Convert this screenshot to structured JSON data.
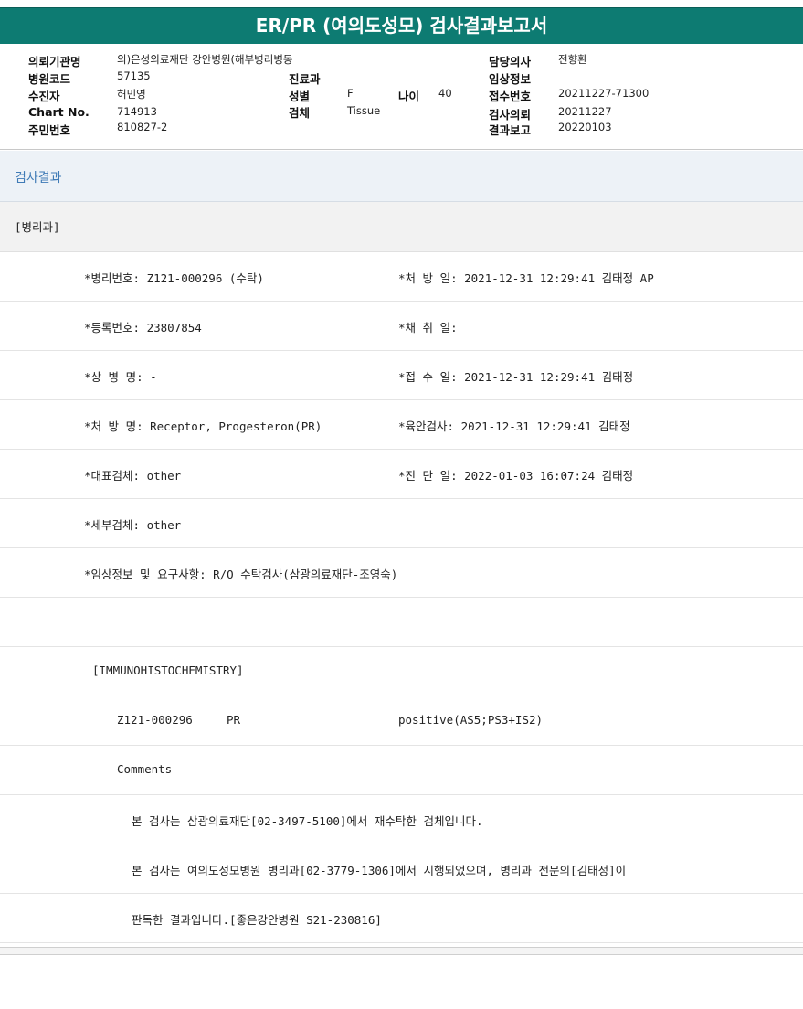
{
  "title": "ER/PR (여의도성모) 검사결과보고서",
  "info": {
    "institution_label": "의뢰기관명",
    "institution": "의)은성의료재단 강안병원(해부병리병동",
    "hospital_code_label": "병원코드",
    "hospital_code": "57135",
    "patient_label": "수진자",
    "patient": "허민영",
    "chart_label": "Chart No.",
    "chart": "714913",
    "rrn_label": "주민번호",
    "rrn": "810827-2",
    "dept_label": "진료과",
    "dept": "",
    "sex_label": "성별",
    "sex": "F",
    "age_label": "나이",
    "age": "40",
    "specimen_label": "검체",
    "specimen": "Tissue",
    "doctor_label": "담당의사",
    "doctor": "전향환",
    "clinical_label": "임상정보",
    "clinical": "",
    "receipt_label": "접수번호",
    "receipt": "20211227-71300",
    "request_label": "검사의뢰",
    "request": "20211227",
    "report_label": "결과보고",
    "report": "20220103"
  },
  "result_header": "검사결과",
  "dept_header": "[병리과]",
  "rows": {
    "path_no": "*병리번호: Z121-000296 (수탁)",
    "order_date": "*처 방 일: 2021-12-31 12:29:41  김태정 AP",
    "reg_no": "*등록번호: 23807854",
    "collect_date": "*채 취 일:",
    "diagnosis": "*상 병 명: -",
    "receipt_date": "*접 수 일: 2021-12-31 12:29:41  김태정",
    "order_name": "*처 방 명: Receptor, Progesteron(PR)",
    "gross_date": "*육안검사: 2021-12-31 12:29:41  김태정",
    "rep_specimen": "*대표검체: other",
    "dx_date": "*진 단 일: 2022-01-03 16:07:24  김태정",
    "sub_specimen": "*세부검체: other",
    "clinical_req": "*임상정보 및 요구사항: R/O 수탁검사(삼광의료재단-조영숙)",
    "ihc_header": "[IMMUNOHISTOCHEMISTRY]",
    "ihc_case": "Z121-000296",
    "ihc_marker": "PR",
    "ihc_result": "positive(AS5;PS3+IS2)",
    "comments": "Comments",
    "comment1": "본 검사는 삼광의료재단[02-3497-5100]에서 재수탁한 검체입니다.",
    "comment2": "본 검사는 여의도성모병원 병리과[02-3779-1306]에서 시행되었으며, 병리과 전문의[김태정]이",
    "comment3": "판독한 결과입니다.[좋은강안병원 S21-230816]"
  }
}
